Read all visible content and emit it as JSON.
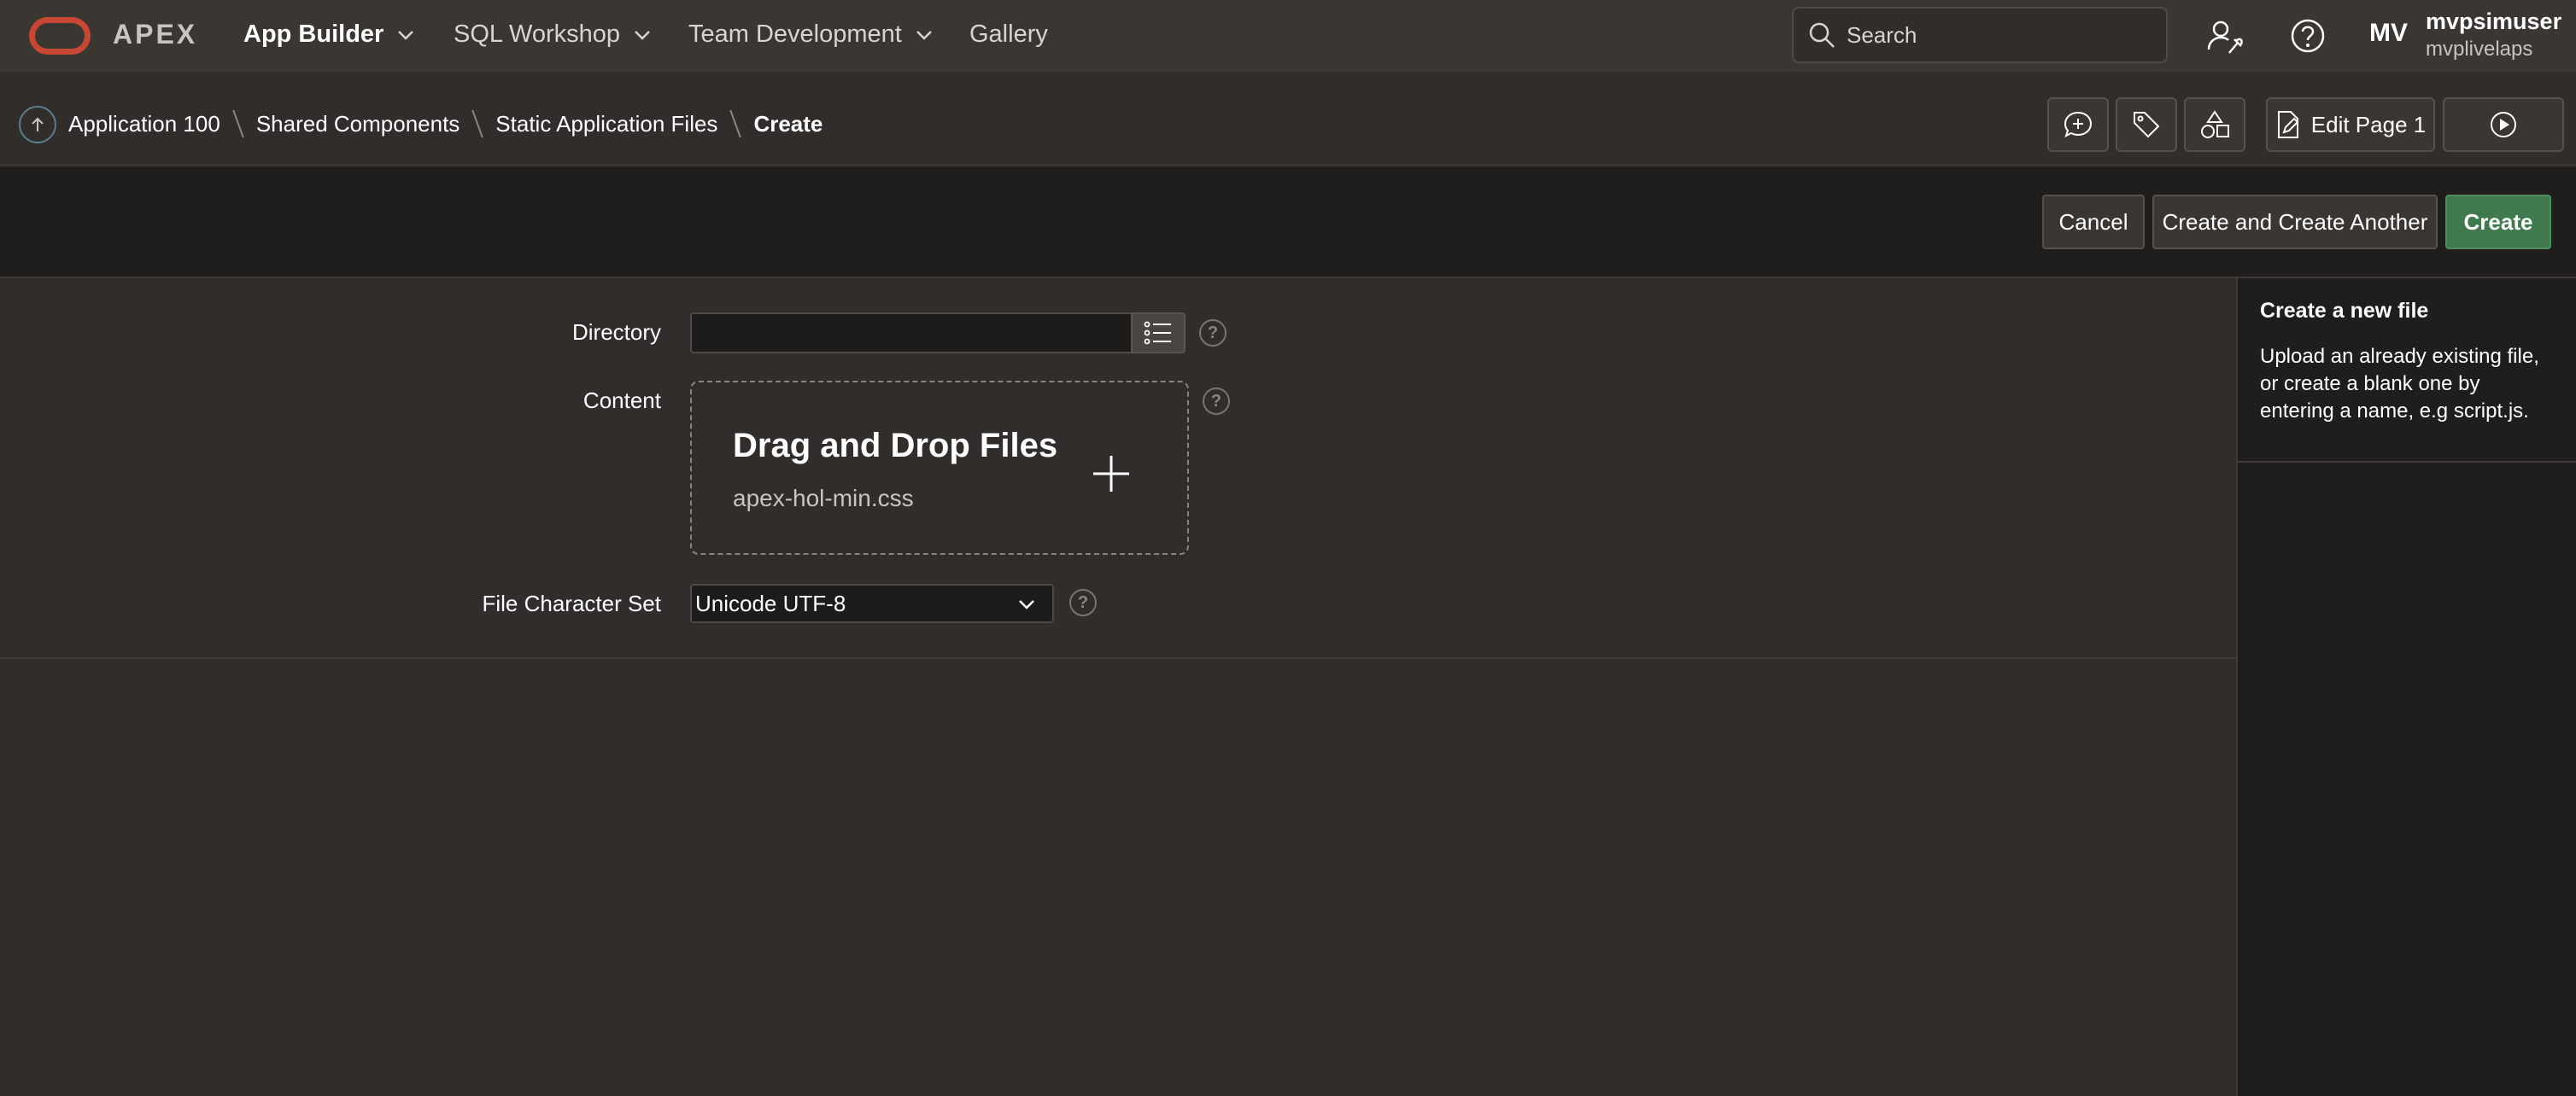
{
  "app": {
    "brand": "APEX",
    "accent_color": "#c74634"
  },
  "nav": {
    "items": [
      {
        "label": "App Builder",
        "has_menu": true,
        "active": true
      },
      {
        "label": "SQL Workshop",
        "has_menu": true,
        "active": false
      },
      {
        "label": "Team Development",
        "has_menu": true,
        "active": false
      },
      {
        "label": "Gallery",
        "has_menu": false,
        "active": false
      }
    ],
    "search_placeholder": "Search",
    "admin_icon": "wrench-user-icon",
    "help_icon": "help-circle-icon"
  },
  "user": {
    "initials": "MV",
    "name": "mvpsimuser",
    "workspace": "mvplivelaps"
  },
  "breadcrumb": {
    "up_icon": "arrow-up-circle-icon",
    "items": [
      "Application 100",
      "Shared Components",
      "Static Application Files"
    ],
    "current": "Create"
  },
  "toolbar": {
    "comment_icon": "chat-plus-icon",
    "tag_icon": "tag-icon",
    "shared_components_icon": "shapes-icon",
    "edit_page_label": "Edit Page 1",
    "run_icon": "play-circle-icon"
  },
  "actions": {
    "cancel": "Cancel",
    "create_another": "Create and Create Another",
    "create": "Create",
    "primary_color": "#3f7a4e"
  },
  "form": {
    "directory_label": "Directory",
    "directory_value": "",
    "content_label": "Content",
    "dropzone_title": "Drag and Drop Files",
    "dropzone_file": "apex-hol-min.css",
    "charset_label": "File Character Set",
    "charset_value": "Unicode UTF-8"
  },
  "help_panel": {
    "title": "Create a new file",
    "text": "Upload an already existing file, or create a blank one by entering a name, e.g script.js."
  }
}
